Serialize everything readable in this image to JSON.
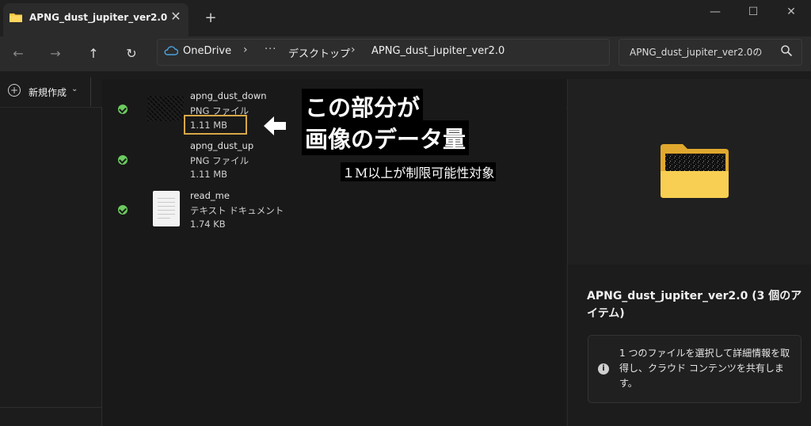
{
  "tab": {
    "title": "APNG_dust_jupiter_ver2.0",
    "close_symbol": "✕",
    "new_tab_symbol": "+"
  },
  "window": {
    "minimize_symbol": "—",
    "maximize_symbol": "☐",
    "close_symbol": "✕"
  },
  "nav": {
    "back_symbol": "←",
    "forward_symbol": "→",
    "up_symbol": "↑",
    "refresh_symbol": "↻",
    "breadcrumbs": [
      "OneDrive",
      "デスクトップ",
      "APNG_dust_jupiter_ver2.0"
    ],
    "separator": "›",
    "more_symbol": "···",
    "search_text": "APNG_dust_jupiter_ver2.0の"
  },
  "toolbar": {
    "new_label": "新規作成",
    "new_plus": "+",
    "new_chevron": "⌄"
  },
  "files": [
    {
      "name": "apng_dust_down",
      "type": "PNG ファイル",
      "size": "1.11 MB"
    },
    {
      "name": "apng_dust_up",
      "type": "PNG ファイル",
      "size": "1.11 MB"
    },
    {
      "name": "read_me",
      "type": "テキスト ドキュメント",
      "size": "1.74 KB"
    }
  ],
  "annotation": {
    "line1": "この部分が",
    "line2": "画像のデータ量",
    "note": "１M以上が制限可能性対象"
  },
  "details": {
    "title": "APNG_dust_jupiter_ver2.0 (3 個のアイテム)",
    "info_symbol": "i",
    "info_text": "1 つのファイルを選択して詳細情報を取得し、クラウド コンテンツを共有します。"
  },
  "colors": {
    "accent_status": "#6ccb5f",
    "highlight_box": "#d7a848",
    "folder": "#f5c342"
  }
}
